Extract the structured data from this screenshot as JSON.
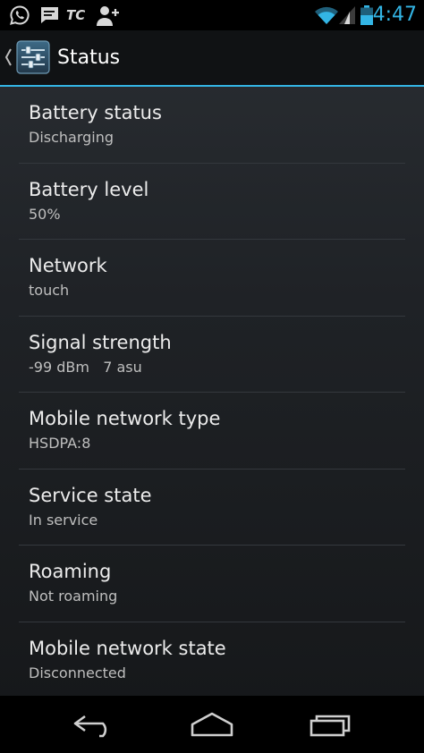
{
  "status_bar": {
    "time": "4:47",
    "notification_text": "TC",
    "icons": [
      "whatsapp-icon",
      "message-icon",
      "tc-icon",
      "add-contact-icon",
      "wifi-icon",
      "cell-signal-icon",
      "battery-icon"
    ],
    "accent_color": "#33b5e5"
  },
  "action_bar": {
    "title": "Status",
    "icon": "settings-sliders-icon",
    "up_icon": "caret-left-icon"
  },
  "items": [
    {
      "title": "Battery status",
      "summary": "Discharging"
    },
    {
      "title": "Battery level",
      "summary": "50%"
    },
    {
      "title": "Network",
      "summary": "touch"
    },
    {
      "title": "Signal strength",
      "summary": "-99 dBm   7 asu"
    },
    {
      "title": "Mobile network type",
      "summary": "HSDPA:8"
    },
    {
      "title": "Service state",
      "summary": "In service"
    },
    {
      "title": "Roaming",
      "summary": "Not roaming"
    },
    {
      "title": "Mobile network state",
      "summary": "Disconnected"
    }
  ],
  "nav_bar": {
    "buttons": [
      "back-icon",
      "home-icon",
      "recent-apps-icon"
    ]
  }
}
